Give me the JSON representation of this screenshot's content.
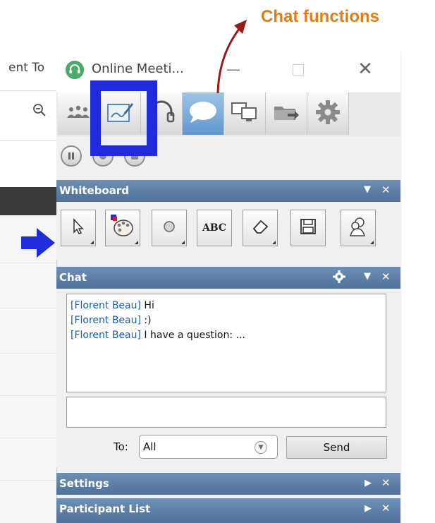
{
  "background_app": {
    "tab_text": "ent To",
    "zoom_icon": "zoom-out-icon"
  },
  "window": {
    "title": "Online Meeti...",
    "logo_icon": "headset-logo-icon",
    "controls": {
      "minimize": "—",
      "close": "✕"
    }
  },
  "toolbar": {
    "buttons": [
      {
        "name": "participants",
        "icon": "participants-icon"
      },
      {
        "name": "whiteboard",
        "icon": "whiteboard-icon",
        "highlighted": true
      },
      {
        "name": "audio",
        "icon": "headset-icon"
      },
      {
        "name": "chat",
        "icon": "chat-bubble-icon",
        "selected": true
      },
      {
        "name": "screen-share",
        "icon": "screen-share-icon"
      },
      {
        "name": "file-share",
        "icon": "folder-share-icon"
      },
      {
        "name": "settings",
        "icon": "gear-icon"
      }
    ],
    "recording_buttons": [
      "pause-icon",
      "record-icon",
      "stop-record-icon"
    ]
  },
  "panels": {
    "whiteboard": {
      "title": "Whiteboard"
    },
    "chat": {
      "title": "Chat"
    },
    "settings": {
      "title": "Settings"
    },
    "participant_list": {
      "title": "Participant List"
    }
  },
  "whiteboard_tools": [
    "pointer-icon",
    "palette-icon",
    "circle-icon",
    "abc-text-icon",
    "eraser-icon",
    "save-icon",
    "user-cards-icon"
  ],
  "whiteboard_text_tool_label": "ABC",
  "chat": {
    "messages": [
      {
        "author": "[Florent Beau]",
        "text": " Hi"
      },
      {
        "author": "[Florent Beau]",
        "text": " :)"
      },
      {
        "author": "[Florent Beau]",
        "text": " I have a question: ..."
      }
    ],
    "input_value": "",
    "to_label": "To:",
    "to_value": "All",
    "send_label": "Send"
  },
  "annotation": {
    "label": "Chat functions",
    "label_color": "#e27d13",
    "box_color": "#1f2bdc",
    "arrow_color": "#9a1a1a"
  },
  "colors": {
    "panel_header": "#5b7ea8",
    "selected_tool": "#6ea4d8",
    "chat_author": "#1a5fb4"
  }
}
